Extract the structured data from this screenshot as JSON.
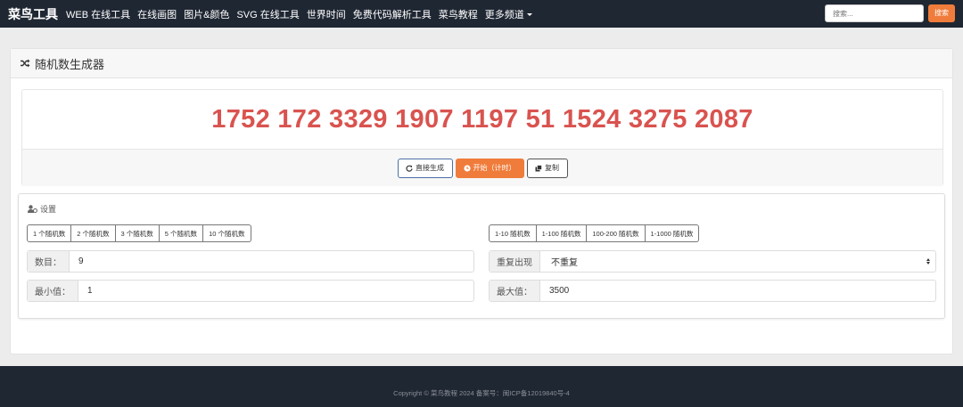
{
  "nav": {
    "brand": "菜鸟工具",
    "items": [
      {
        "label": "WEB 在线工具"
      },
      {
        "label": "在线画图"
      },
      {
        "label": "图片&颜色"
      },
      {
        "label": "SVG 在线工具"
      },
      {
        "label": "世界时间"
      },
      {
        "label": "免费代码解析工具"
      },
      {
        "label": "菜鸟教程"
      },
      {
        "label": "更多频道"
      }
    ],
    "search_placeholder": "搜索...",
    "search_button": "搜索"
  },
  "panel": {
    "title": "随机数生成器",
    "title_icon": "shuffle-icon"
  },
  "result": {
    "numbers": "1752 172 3329 1907 1197 51 1524 3275 2087",
    "color": "#d9534f"
  },
  "actions": {
    "regenerate": {
      "label": "直接生成",
      "icon": "refresh-icon"
    },
    "start": {
      "label": "开始（计时）",
      "icon": "clock-icon"
    },
    "copy": {
      "label": "复制",
      "icon": "copy-icon"
    }
  },
  "settings": {
    "title": "设置",
    "title_icon": "user-settings-icon",
    "count_presets": [
      "1 个随机数",
      "2 个随机数",
      "3 个随机数",
      "5 个随机数",
      "10 个随机数"
    ],
    "range_presets": [
      "1-10 随机数",
      "1-100 随机数",
      "100-200 随机数",
      "1-1000 随机数"
    ],
    "count": {
      "label": "数目：",
      "value": "9"
    },
    "repeat": {
      "label": "重复出现",
      "value": "不重复"
    },
    "min": {
      "label": "最小值：",
      "value": "1"
    },
    "max": {
      "label": "最大值：",
      "value": "3500"
    }
  },
  "footer": {
    "text": "Copyright © 菜鸟教程 2024 备案号：闽ICP备12019840号-4"
  },
  "colors": {
    "navbar_bg": "#1f2733",
    "accent": "#f07c3b",
    "number_red": "#d9534f"
  }
}
